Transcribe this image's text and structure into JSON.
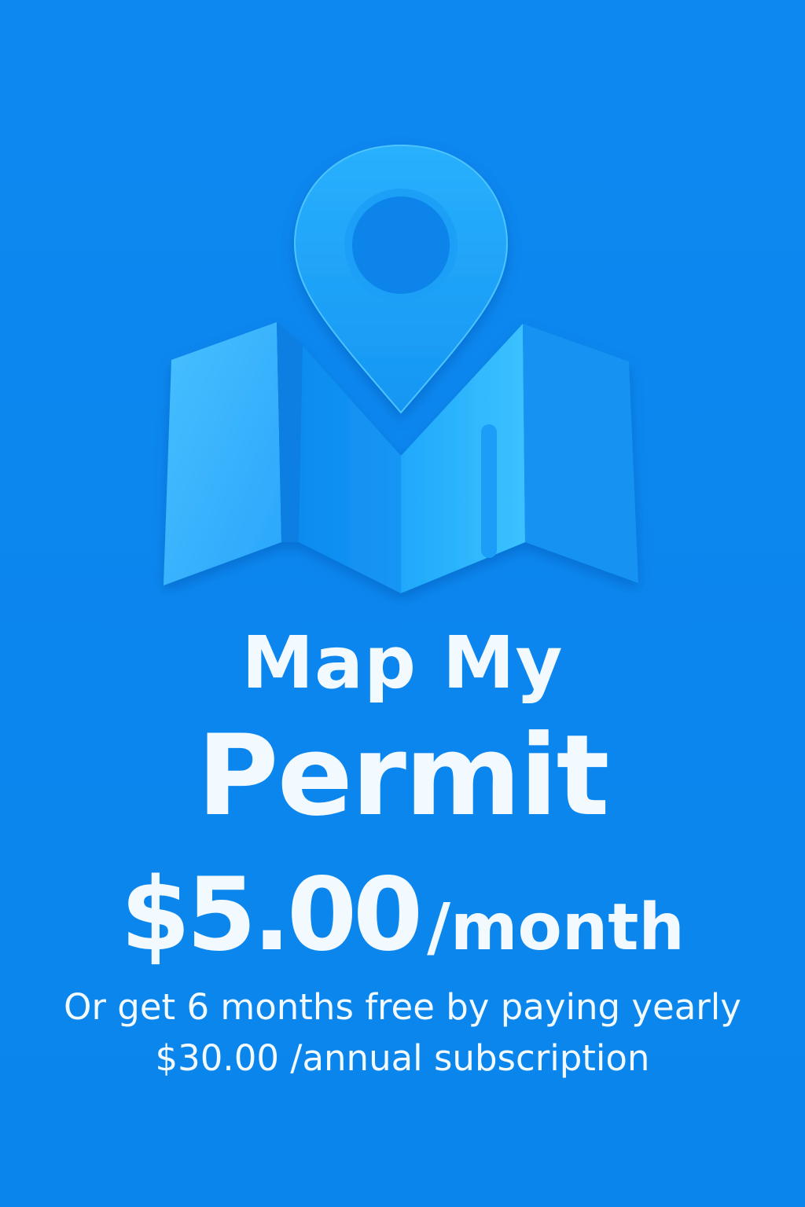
{
  "logo": {
    "icon": "folded-map-with-location-pin-icon"
  },
  "title": {
    "line1": "Map My",
    "line2": "Permit"
  },
  "pricing": {
    "monthly_price": "$5.00",
    "monthly_period": "/month",
    "offer": "Or get 6 months free by paying yearly",
    "annual": "$30.00 /annual subscription"
  },
  "colors": {
    "background": "#0a86ee",
    "text": "#f2f9ff",
    "icon_light": "#3cc0ff",
    "icon_mid": "#1a9cf5"
  }
}
